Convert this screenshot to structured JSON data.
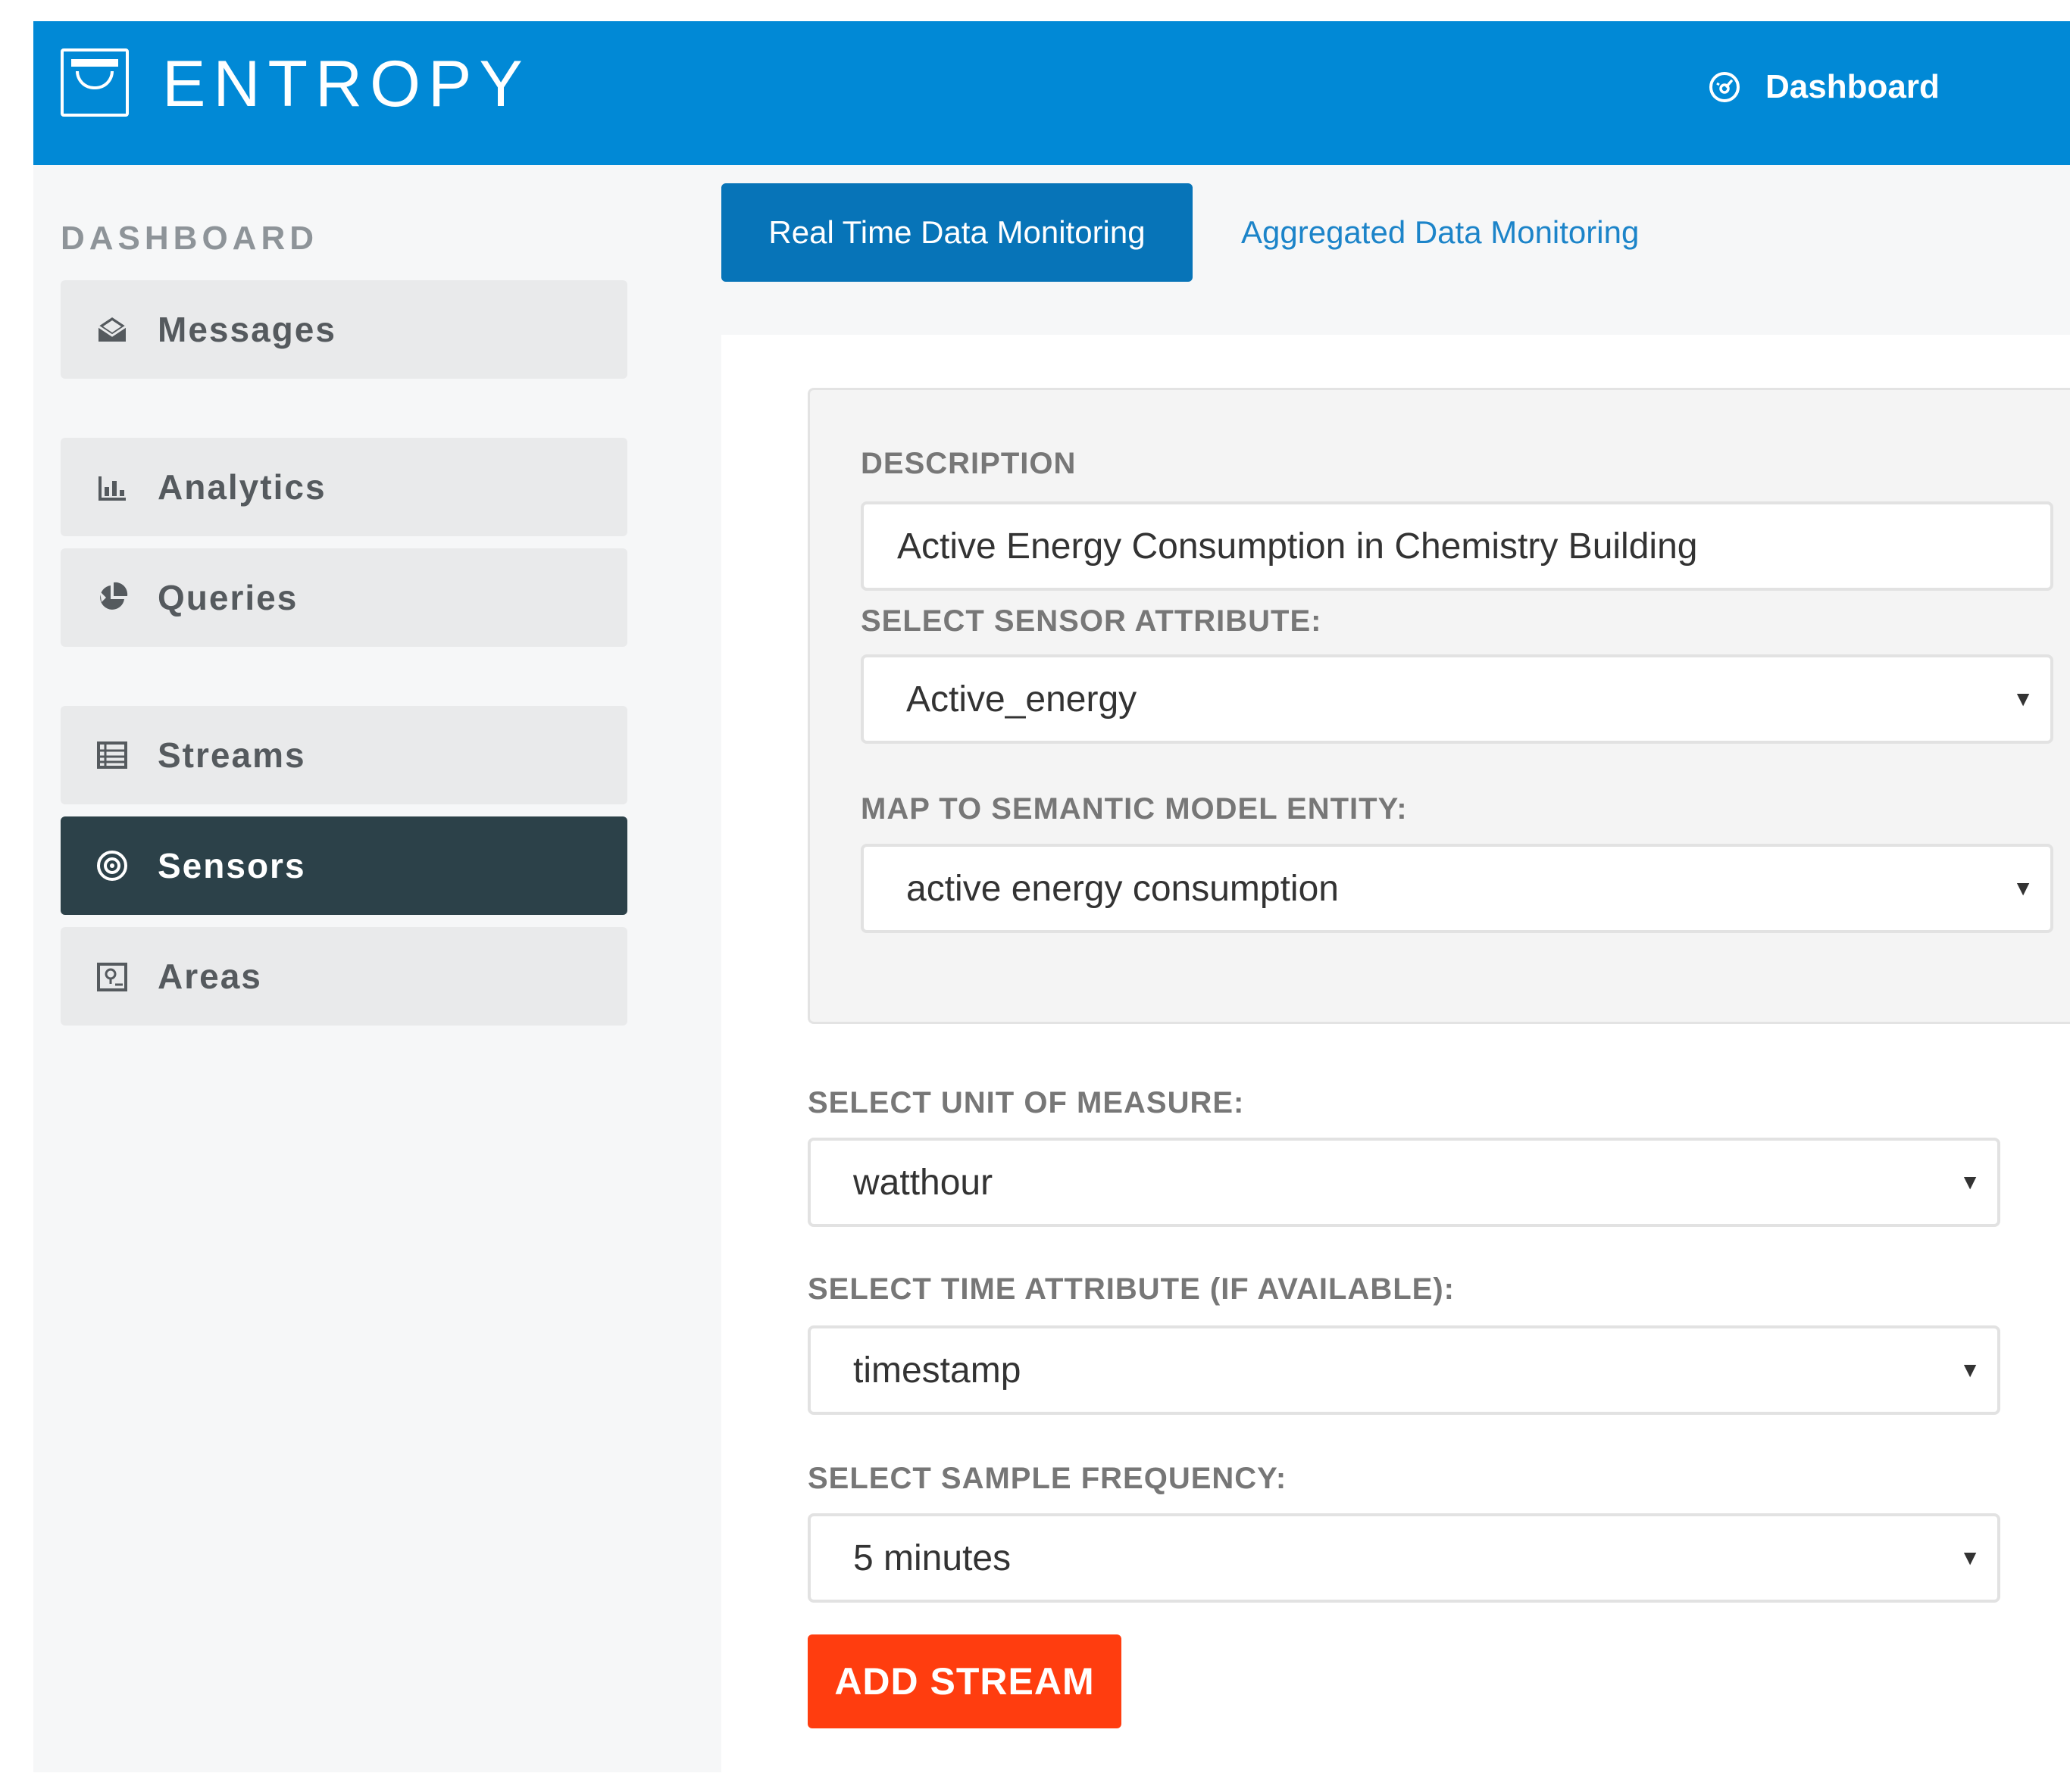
{
  "header": {
    "logo_text": "ENTROPY",
    "dashboard_link": "Dashboard",
    "dashboard_icon": "dashboard-icon",
    "bg_color": "#0189d6"
  },
  "sidebar": {
    "title": "DASHBOARD",
    "items": [
      {
        "label": "Messages",
        "icon": "envelope-open-icon",
        "active": false
      },
      {
        "label": "Analytics",
        "icon": "bar-chart-icon",
        "active": false
      },
      {
        "label": "Queries",
        "icon": "pie-chart-icon",
        "active": false
      },
      {
        "label": "Streams",
        "icon": "list-table-icon",
        "active": false
      },
      {
        "label": "Sensors",
        "icon": "target-icon",
        "active": true
      },
      {
        "label": "Areas",
        "icon": "map-pin-icon",
        "active": false
      }
    ]
  },
  "tabs": [
    {
      "label": "Real Time Data Monitoring",
      "active": true
    },
    {
      "label": "Aggregated Data Monitoring",
      "active": false
    }
  ],
  "form": {
    "description_label": "DESCRIPTION",
    "description_value": "Active Energy Consumption in Chemistry Building",
    "sensor_attribute_label": "SELECT SENSOR ATTRIBUTE:",
    "sensor_attribute_value": "Active_energy",
    "semantic_entity_label": "MAP TO SEMANTIC MODEL ENTITY:",
    "semantic_entity_value": "active energy consumption",
    "unit_label": "SELECT UNIT OF MEASURE:",
    "unit_value": "watthour",
    "time_attribute_label": "SELECT TIME ATTRIBUTE (IF AVAILABLE):",
    "time_attribute_value": "timestamp",
    "frequency_label": "SELECT SAMPLE FREQUENCY:",
    "frequency_value": "5 minutes",
    "caret": "▼",
    "submit_label": "ADD STREAM",
    "submit_color": "#ff3d0f"
  }
}
